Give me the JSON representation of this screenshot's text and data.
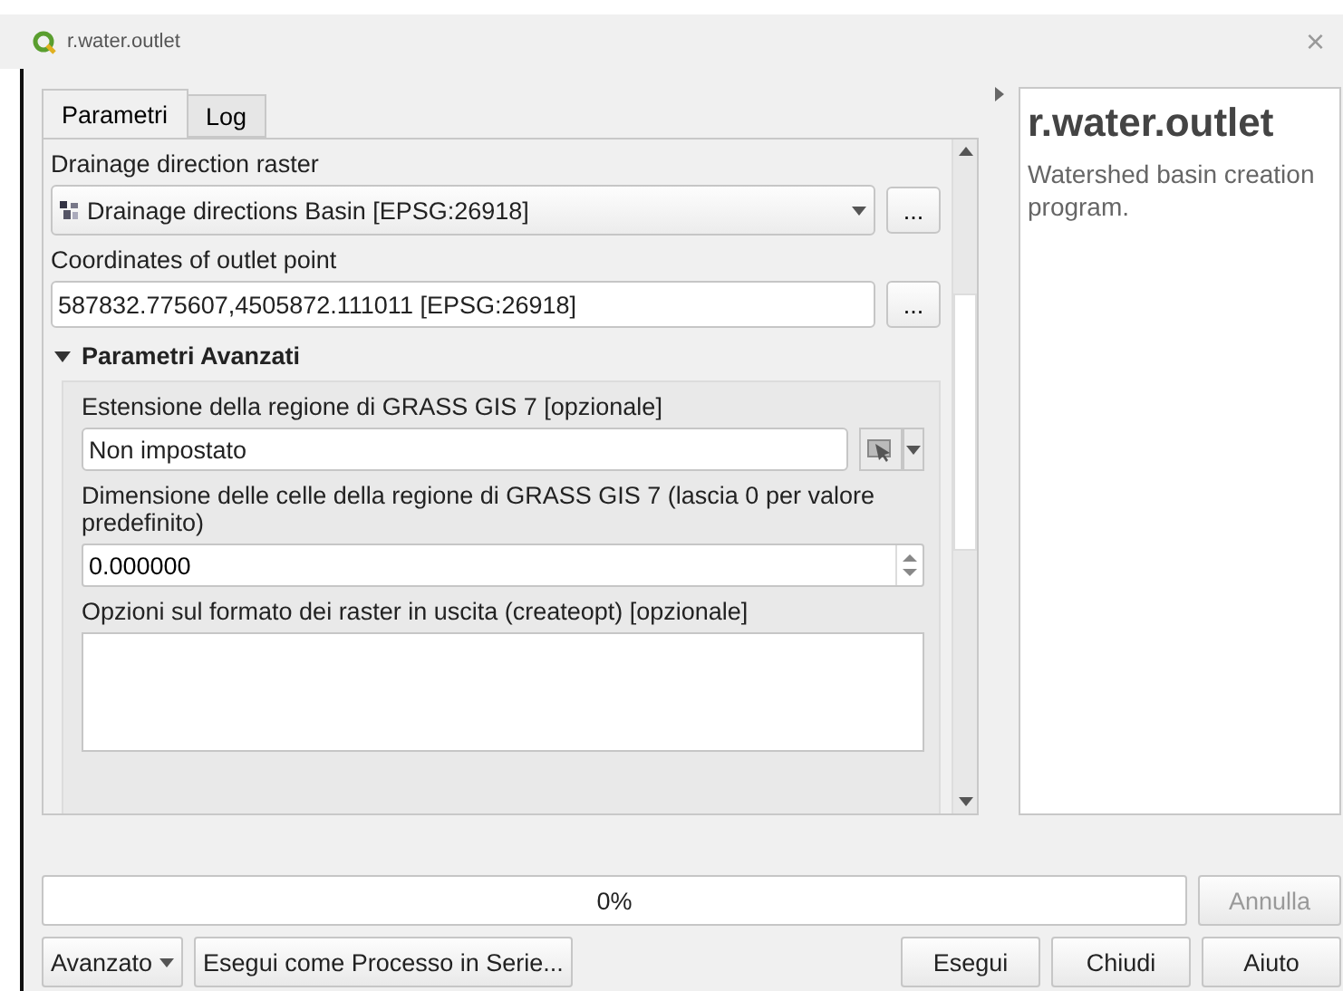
{
  "window": {
    "title": "r.water.outlet",
    "close": "×"
  },
  "tabs": [
    {
      "label": "Parametri",
      "selected": true
    },
    {
      "label": "Log",
      "selected": false
    }
  ],
  "parameters": [
    {
      "kind": "combo",
      "label": "Drainage direction raster",
      "value": "Drainage directions Basin [EPSG:26918]",
      "button": "..."
    },
    {
      "kind": "text",
      "label": "Coordinates of outlet point",
      "value": "587832.775607,4505872.111011 [EPSG:26918]",
      "button": "..."
    }
  ],
  "advanced": {
    "title": "Parametri Avanzati",
    "expanded": true,
    "parameters": [
      {
        "kind": "extent",
        "label": "Estensione della regione di GRASS GIS 7 [opzionale]",
        "value": "Non impostato"
      },
      {
        "kind": "spin",
        "label": "Dimensione delle celle della regione di GRASS GIS 7 (lascia 0 per valore predefinito)",
        "value": "0.000000"
      },
      {
        "kind": "textarea",
        "label": "Opzioni sul formato dei raster in uscita (createopt) [opzionale]"
      }
    ]
  },
  "help": {
    "title": "r.water.outlet",
    "text": "Watershed basin creation program."
  },
  "progress": {
    "level": 0,
    "reading": "0%"
  },
  "cancel": {
    "label": "Annulla",
    "disabled": true
  },
  "buttons_left": [
    {
      "label": "Avanzato",
      "dropdown": true
    },
    {
      "label": "Esegui come Processo in Serie...",
      "dropdown": false
    }
  ],
  "buttons_right": [
    {
      "label": "Esegui"
    },
    {
      "label": "Chiudi"
    },
    {
      "label": "Aiuto"
    }
  ]
}
